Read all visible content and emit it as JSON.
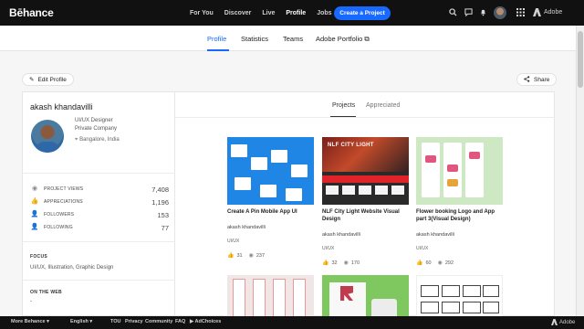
{
  "topnav": {
    "logo": "Bēhance",
    "links": [
      {
        "label": "For You"
      },
      {
        "label": "Discover"
      },
      {
        "label": "Live"
      },
      {
        "label": "Profile",
        "active": true
      },
      {
        "label": "Jobs"
      }
    ],
    "create_label": "Create a Project",
    "brand": "Adobe",
    "icons": [
      "search-icon",
      "chat-icon",
      "bell-icon",
      "grid-icon"
    ]
  },
  "subnav": {
    "links": [
      "Profile",
      "Statistics",
      "Teams",
      "Adobe Portfolio ⧉"
    ],
    "active": "Profile"
  },
  "actions": {
    "edit_label": "Edit Profile",
    "share_label": "Share"
  },
  "profile": {
    "name": "akash khandavilli",
    "title": "UI/UX Designer",
    "company": "Private Company",
    "location": "Bangalore, India",
    "stats": [
      {
        "label": "PROJECT VIEWS",
        "value": "7,408",
        "icon": "eye-icon"
      },
      {
        "label": "APPRECIATIONS",
        "value": "1,196",
        "icon": "thumbs-up-icon"
      },
      {
        "label": "FOLLOWERS",
        "value": "153",
        "icon": "user-icon"
      },
      {
        "label": "FOLLOWING",
        "value": "77",
        "icon": "user-icon"
      }
    ],
    "focus_title": "FOCUS",
    "focus_text": "UI/UX, Illustration, Graphic Design",
    "web_title": "ON THE WEB",
    "web_text": "-"
  },
  "tabs": [
    "Projects",
    "Appreciated"
  ],
  "projects": [
    {
      "title": "Create A Pin Mobile App UI",
      "author": "akash khandavilli",
      "field": "UI/UX",
      "likes": "31",
      "views": "237"
    },
    {
      "title": "NLF City Light Website Visual Design",
      "author": "akash khandavilli",
      "field": "UI/UX",
      "likes": "32",
      "views": "170",
      "thumb_text": "NLF CITY LIGHT"
    },
    {
      "title": "Flower booking Logo and App part 3(Visual Design)",
      "author": "akash khandavilli",
      "field": "UI/UX",
      "likes": "60",
      "views": "292"
    }
  ],
  "footer": {
    "links": [
      "More Behance ▾",
      "English ▾",
      "TOU",
      "Privacy",
      "Community",
      "FAQ",
      "▶ AdChoices"
    ],
    "brand": "Adobe"
  },
  "colors": {
    "accent": "#1769ff",
    "nav_bg": "#111111"
  }
}
